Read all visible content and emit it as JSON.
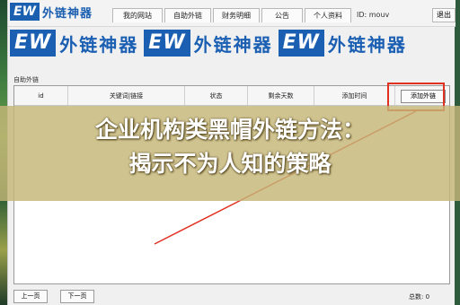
{
  "logo": {
    "ew": "EW",
    "name": "外链神器"
  },
  "tabs": [
    "我的网站",
    "自助外链",
    "财务明细",
    "公告",
    "个人资料"
  ],
  "user": {
    "id_label": "ID: mouv"
  },
  "window": {
    "close_label": "退出"
  },
  "watermark": [
    "外链神器",
    "外链神器",
    "外链神器"
  ],
  "group": {
    "title": "自助外链"
  },
  "table": {
    "columns": [
      "id",
      "关键词|链接",
      "状态",
      "剩余天数",
      "添加时间"
    ],
    "add_button": "添加外链"
  },
  "overlay": {
    "line1": "企业机构类黑帽外链方法：",
    "line2": "揭示不为人知的策略"
  },
  "pager": {
    "prev": "上一页",
    "next": "下一页",
    "total": "总数: 0"
  },
  "colors": {
    "brand": "#1b5fb3",
    "annotation": "#e03020",
    "overlay": "#c4b678"
  }
}
